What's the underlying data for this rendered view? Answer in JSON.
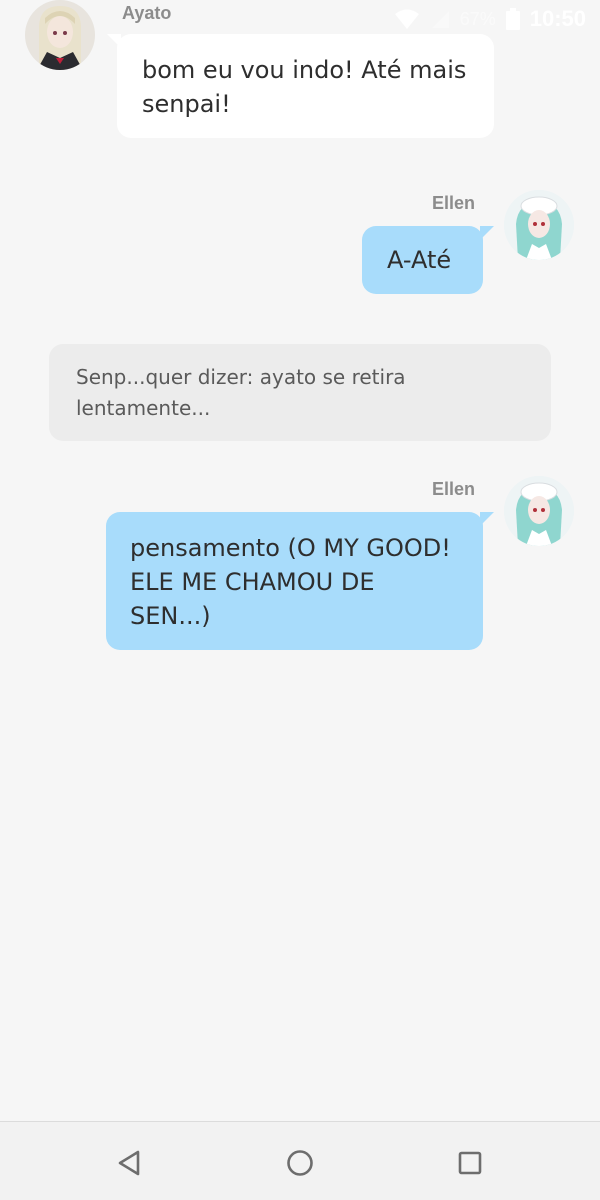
{
  "status_bar": {
    "battery_percent": "67%",
    "time": "10:50",
    "icons": [
      "wifi-icon",
      "signal-icon",
      "battery-icon"
    ]
  },
  "messages": [
    {
      "type": "incoming",
      "sender": "Ayato",
      "avatar": "ayato-avatar",
      "text": "bom eu vou indo! Até mais\nsenpai!"
    },
    {
      "type": "outgoing",
      "sender": "Ellen",
      "avatar": "ellen-avatar",
      "text": "A-Até"
    },
    {
      "type": "narration",
      "text": "Senp...quer dizer: ayato se retira\nlentamente..."
    },
    {
      "type": "outgoing",
      "sender": "Ellen",
      "avatar": "ellen-avatar",
      "text": "pensamento (O MY GOOD!\nELE ME CHAMOU DE\nSEN...)"
    }
  ],
  "nav_bar": {
    "icons": [
      "back-icon",
      "home-icon",
      "recents-icon"
    ]
  },
  "colors": {
    "background": "#f6f6f6",
    "incoming_bubble": "#ffffff",
    "outgoing_bubble": "#a8dcfb",
    "narration_bubble": "#ececec",
    "sender_name": "#8c8c8c"
  }
}
